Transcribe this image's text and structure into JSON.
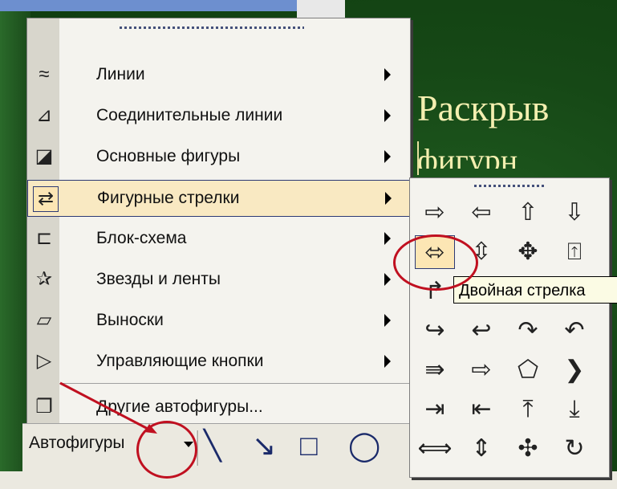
{
  "slide": {
    "title": "Раскрыв",
    "subtitle_fragment": "фигурн"
  },
  "menu": {
    "items": [
      {
        "label": "Линии",
        "icon": "lines-icon",
        "glyph": "≈",
        "submenu": true
      },
      {
        "label": "Соединительные линии",
        "icon": "connectors-icon",
        "glyph": "⊿",
        "submenu": true
      },
      {
        "label": "Основные фигуры",
        "icon": "basic-shapes-icon",
        "glyph": "◪",
        "submenu": true
      },
      {
        "label": "Фигурные стрелки",
        "icon": "block-arrows-icon",
        "glyph": "⇄",
        "submenu": true,
        "highlighted": true
      },
      {
        "label": "Блок-схема",
        "icon": "flowchart-icon",
        "glyph": "⊏",
        "submenu": true
      },
      {
        "label": "Звезды и ленты",
        "icon": "stars-banners-icon",
        "glyph": "✰",
        "submenu": true
      },
      {
        "label": "Выноски",
        "icon": "callouts-icon",
        "glyph": "▱",
        "submenu": true
      },
      {
        "label": "Управляющие кнопки",
        "icon": "action-buttons-icon",
        "glyph": "▷",
        "submenu": true
      }
    ],
    "other": {
      "label": "Другие автофигуры...",
      "icon": "more-autoshapes-icon",
      "glyph": "❐"
    }
  },
  "toolbar": {
    "autoshapes_label": "Автофигуры",
    "tools": [
      {
        "icon": "line-tool-icon",
        "glyph": "╲"
      },
      {
        "icon": "arrow-tool-icon",
        "glyph": "↘"
      },
      {
        "icon": "rectangle-tool-icon",
        "glyph": "□"
      },
      {
        "icon": "oval-tool-icon",
        "glyph": "◯"
      }
    ]
  },
  "submenu": {
    "shapes": [
      {
        "name": "right-arrow-icon",
        "glyph": "⇨"
      },
      {
        "name": "left-arrow-icon",
        "glyph": "⇦"
      },
      {
        "name": "up-arrow-icon",
        "glyph": "⇧"
      },
      {
        "name": "down-arrow-icon",
        "glyph": "⇩"
      },
      {
        "name": "left-right-arrow-icon",
        "glyph": "⬄",
        "selected": true
      },
      {
        "name": "up-down-arrow-icon",
        "glyph": "⇳"
      },
      {
        "name": "quad-arrow-icon",
        "glyph": "✥"
      },
      {
        "name": "left-right-up-arrow-icon",
        "glyph": "⍐"
      },
      {
        "name": "bent-arrow-icon",
        "glyph": "↱"
      },
      {
        "name": "u-turn-arrow-icon",
        "glyph": ""
      },
      {
        "name": "left-up-arrow-icon",
        "glyph": ""
      },
      {
        "name": "bent-up-arrow-icon",
        "glyph": ""
      },
      {
        "name": "curved-right-arrow-icon",
        "glyph": "↪"
      },
      {
        "name": "curved-left-arrow-icon",
        "glyph": "↩"
      },
      {
        "name": "curved-up-arrow-icon",
        "glyph": "↷"
      },
      {
        "name": "curved-down-arrow-icon",
        "glyph": "↶"
      },
      {
        "name": "striped-right-arrow-icon",
        "glyph": "⇛"
      },
      {
        "name": "notched-right-arrow-icon",
        "glyph": "⇨"
      },
      {
        "name": "pentagon-icon",
        "glyph": "⬠"
      },
      {
        "name": "chevron-icon",
        "glyph": "❯"
      },
      {
        "name": "right-arrow-callout-icon",
        "glyph": "⇥"
      },
      {
        "name": "left-arrow-callout-icon",
        "glyph": "⇤"
      },
      {
        "name": "up-arrow-callout-icon",
        "glyph": "⤒"
      },
      {
        "name": "down-arrow-callout-icon",
        "glyph": "⤓"
      },
      {
        "name": "left-right-arrow-callout-icon",
        "glyph": "⟺"
      },
      {
        "name": "up-down-arrow-callout-icon",
        "glyph": "⇕"
      },
      {
        "name": "quad-arrow-callout-icon",
        "glyph": "✣"
      },
      {
        "name": "circular-arrow-icon",
        "glyph": "↻"
      }
    ],
    "tooltip": "Двойная стрелка"
  },
  "colors": {
    "annotation": "#c01020",
    "slide_bg": "#164816",
    "title_text": "#f4efb0",
    "highlight": "#f9e9c2"
  }
}
